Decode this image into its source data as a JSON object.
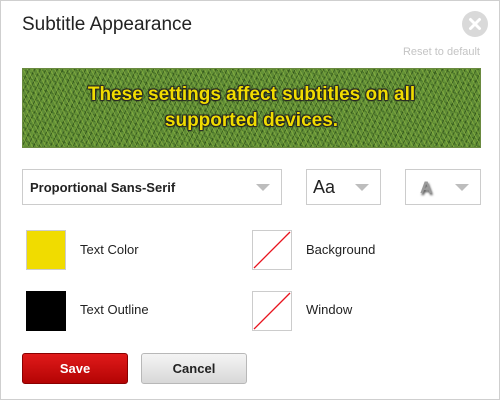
{
  "dialog": {
    "title": "Subtitle Appearance",
    "close_icon": "close-icon",
    "reset_label": "Reset to default"
  },
  "preview": {
    "text": "These settings affect subtitles on all supported devices.",
    "text_color": "#f0dc00",
    "background": "grass-texture"
  },
  "selects": {
    "font": {
      "value": "Proportional Sans-Serif"
    },
    "size": {
      "value": "Aa"
    },
    "shadow": {
      "value": "A"
    }
  },
  "colors": {
    "text_color": {
      "label": "Text Color",
      "value": "#f0dc00"
    },
    "text_outline": {
      "label": "Text Outline",
      "value": "#000000"
    },
    "background": {
      "label": "Background",
      "value": "none"
    },
    "window": {
      "label": "Window",
      "value": "none"
    }
  },
  "buttons": {
    "save_label": "Save",
    "cancel_label": "Cancel",
    "save_color": "#c80808"
  }
}
